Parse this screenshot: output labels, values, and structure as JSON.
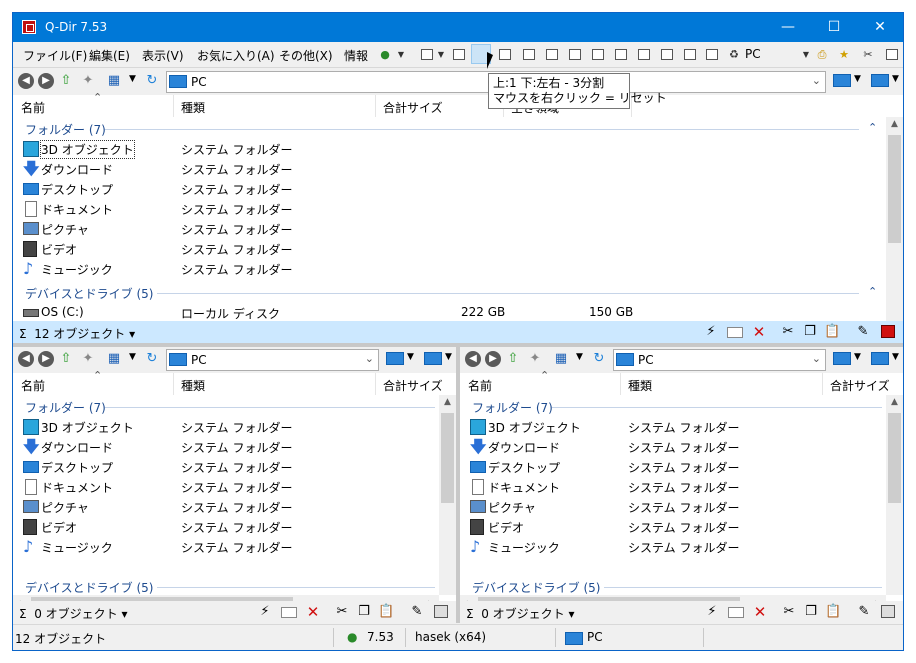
{
  "window": {
    "title": "Q-Dir 7.53"
  },
  "menu": [
    "ファイル(F)",
    "編集(E)",
    "表示(V)",
    "お気に入り(A)",
    "その他(X)",
    "情報"
  ],
  "toolbar": {
    "pc_label": "PC"
  },
  "tooltip": {
    "line1": "上:1 下:左右 - 3分割",
    "line2": "マウスを右クリック = リセット"
  },
  "columns": {
    "name": "名前",
    "type": "種類",
    "total_size": "合計サイズ",
    "free_space": "空き領域"
  },
  "groups": {
    "folders": "フォルダー",
    "folders_count": "(7)",
    "drives": "デバイスとドライブ",
    "drives_count": "(5)"
  },
  "folders": [
    {
      "name": "3D オブジェクト",
      "type": "システム フォルダー",
      "icon": "cube-icon"
    },
    {
      "name": "ダウンロード",
      "type": "システム フォルダー",
      "icon": "download-arrow-icon"
    },
    {
      "name": "デスクトップ",
      "type": "システム フォルダー",
      "icon": "desktop-icon"
    },
    {
      "name": "ドキュメント",
      "type": "システム フォルダー",
      "icon": "document-icon"
    },
    {
      "name": "ピクチャ",
      "type": "システム フォルダー",
      "icon": "picture-icon"
    },
    {
      "name": "ビデオ",
      "type": "システム フォルダー",
      "icon": "video-icon"
    },
    {
      "name": "ミュージック",
      "type": "システム フォルダー",
      "icon": "music-note-icon"
    }
  ],
  "drive": {
    "name": "OS (C:)",
    "type": "ローカル ディスク",
    "total": "222 GB",
    "free": "150 GB"
  },
  "panes": {
    "top": {
      "address": "PC",
      "status": "12 オブジェクト"
    },
    "bottom_left": {
      "address": "PC",
      "status": "0 オブジェクト"
    },
    "bottom_right": {
      "address": "PC",
      "status": "0 オブジェクト"
    }
  },
  "statusbar": {
    "count": "12 オブジェクト",
    "version": "7.53",
    "user": "hasek (x64)",
    "location": "PC"
  },
  "colors": {
    "titlebar": "#0078d7",
    "selection": "#cce8ff",
    "group_text": "#1e4b8f"
  }
}
